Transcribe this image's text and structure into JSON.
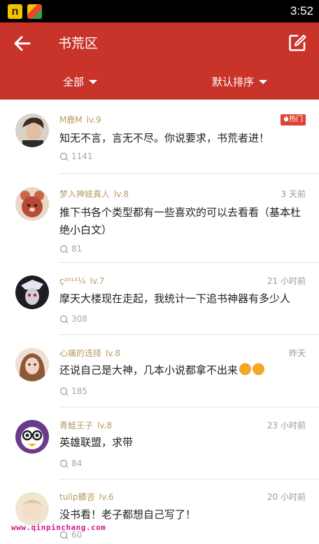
{
  "status_bar": {
    "time": "3:52",
    "app_icon_1": "n",
    "app_icon_2": "game-center-icon"
  },
  "app_bar": {
    "title": "书荒区",
    "back_icon": "arrow-left-icon",
    "compose_icon": "edit-icon"
  },
  "filters": {
    "category": "全部",
    "sort": "默认排序"
  },
  "posts": [
    {
      "user": "M鹿M",
      "level": "lv.9",
      "badge": "热门",
      "time": "",
      "text": "知无不言，言无不尽。你说要求，书荒者进！",
      "comments": "1141"
    },
    {
      "user": "梦入神妓真人",
      "level": "lv.8",
      "badge": "",
      "time": "3 天前",
      "text": "推下书各个类型都有一些喜欢的可以去看看（基本杜绝小白文）",
      "comments": "81"
    },
    {
      "user": "ç²⁰¹³¼",
      "level": "lv.7",
      "badge": "",
      "time": "21 小时前",
      "text": "摩天大楼现在走起，我统计一下追书神器有多少人",
      "comments": "308"
    },
    {
      "user": "心痛的选择",
      "level": "lv.8",
      "badge": "",
      "time": "昨天",
      "text": "还说自己是大神，几本小说都拿不出来",
      "comments": "185"
    },
    {
      "user": "青蛙王子",
      "level": "lv.8",
      "badge": "",
      "time": "23 小时前",
      "text": "英雄联盟，求带",
      "comments": "84"
    },
    {
      "user": "tulip髒咨",
      "level": "lv.6",
      "badge": "",
      "time": "20 小时前",
      "text": "没书看！老子都想自己写了！",
      "comments": "60"
    }
  ],
  "watermark": "www.qinpinchang.com",
  "colors": {
    "primary": "#c9342a",
    "username": "#b89a62",
    "hot_badge": "#e04237"
  }
}
